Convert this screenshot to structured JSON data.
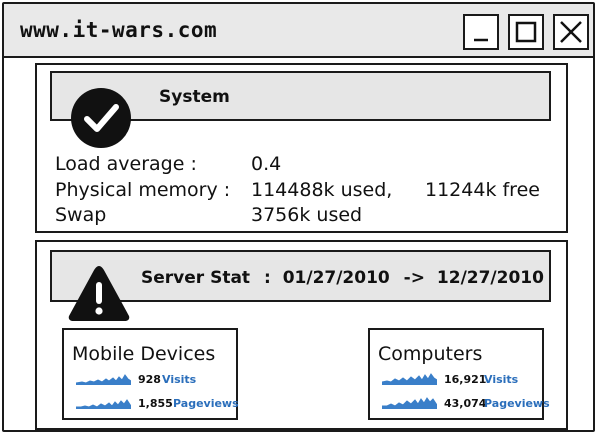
{
  "window": {
    "title": "www.it-wars.com"
  },
  "colors": {
    "link": "#2a6ebb",
    "spark": "#3a7fc9",
    "header_bg": "#e6e6e6",
    "titlebar_bg": "#e9e9e9"
  },
  "system": {
    "header": "System",
    "icon": "check-circle-icon",
    "rows": [
      {
        "label": "Load average :",
        "value": "0.4",
        "extra": ""
      },
      {
        "label": "Physical memory :",
        "value": "114488k used,",
        "extra": "11244k free"
      },
      {
        "label": "Swap",
        "value": "3756k used",
        "extra": ""
      }
    ]
  },
  "server": {
    "icon": "warning-icon",
    "header_label": "Server Stat",
    "header_sep": ":",
    "start_date": "01/27/2010",
    "arrow": "->",
    "end_date": "12/27/2010",
    "boxes": [
      {
        "title": "Mobile Devices",
        "metrics": [
          {
            "value": "928",
            "label": "Visits"
          },
          {
            "value": "1,855",
            "label": "Pageviews"
          }
        ]
      },
      {
        "title": "Computers",
        "metrics": [
          {
            "value": "16,921",
            "label": "Visits"
          },
          {
            "value": "43,074",
            "label": "Pageviews"
          }
        ]
      }
    ]
  }
}
